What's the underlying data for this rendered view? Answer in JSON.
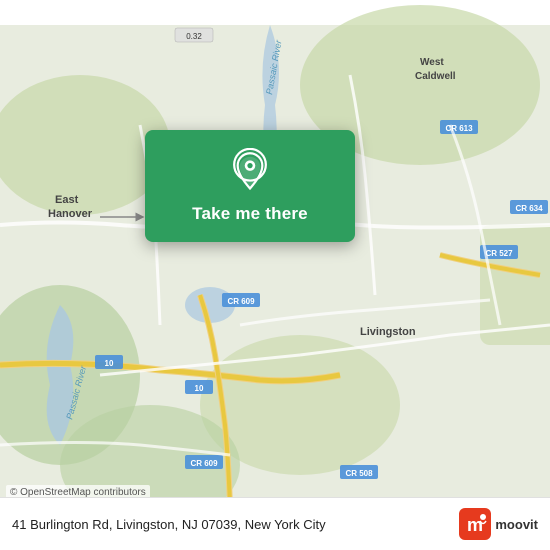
{
  "map": {
    "alt": "Map showing area around 41 Burlington Rd, Livingston, NJ"
  },
  "overlay": {
    "button_label": "Take me there",
    "pin_color": "#ffffff"
  },
  "bottom_bar": {
    "address": "41 Burlington Rd, Livingston, NJ 07039, New York City",
    "logo_name": "moovit"
  },
  "attribution": {
    "text": "© OpenStreetMap contributors"
  }
}
